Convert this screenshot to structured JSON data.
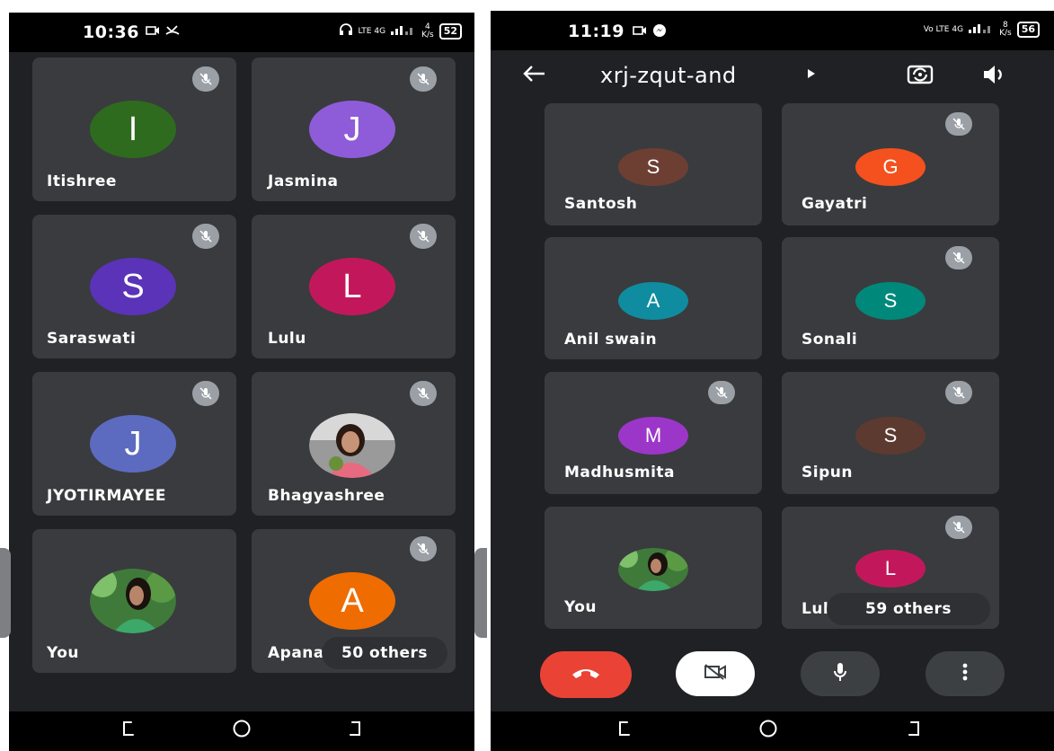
{
  "left": {
    "status": {
      "time": "10:36",
      "network": "LTE 4G",
      "speed_top": "4",
      "speed_unit": "K/s",
      "battery": "52"
    },
    "tiles": [
      {
        "name": "Itishree",
        "initial": "I",
        "color": "#2e6b1f",
        "muted": true
      },
      {
        "name": "Jasmina",
        "initial": "J",
        "color": "#8e5cd9",
        "muted": true
      },
      {
        "name": "Saraswati",
        "initial": "S",
        "color": "#5a33b8",
        "muted": true
      },
      {
        "name": "Lulu",
        "initial": "L",
        "color": "#c2185b",
        "muted": true
      },
      {
        "name": "JYOTIRMAYEE",
        "initial": "J",
        "color": "#5c6bc0",
        "muted": true
      },
      {
        "name": "Bhagyashree",
        "muted": true
      },
      {
        "name": "You",
        "muted": false
      },
      {
        "name": "Apana",
        "initial": "A",
        "color": "#ef6c00",
        "muted": true
      }
    ],
    "others_label": "50 others"
  },
  "right": {
    "status": {
      "time": "11:19",
      "network": "Vo LTE 4G",
      "speed_top": "8",
      "speed_unit": "K/s",
      "battery": "56"
    },
    "meeting_code": "xrj-zqut-and",
    "tiles": [
      {
        "name": "Santosh",
        "initial": "S",
        "color": "#6d3f33",
        "muted": false
      },
      {
        "name": "Gayatri",
        "initial": "G",
        "color": "#f4511e",
        "muted": true
      },
      {
        "name": "Anil swain",
        "initial": "A",
        "color": "#0f8ca0",
        "muted": false
      },
      {
        "name": "Sonali",
        "initial": "S",
        "color": "#00897b",
        "muted": true
      },
      {
        "name": "Madhusmita",
        "initial": "M",
        "color": "#9c36c9",
        "muted": true
      },
      {
        "name": "Sipun",
        "initial": "S",
        "color": "#5d3a30",
        "muted": true
      },
      {
        "name": "You",
        "muted": false
      },
      {
        "name": "Lulu",
        "initial": "L",
        "color": "#c2185b",
        "muted": true
      }
    ],
    "others_label": "59 others"
  },
  "icons": {
    "back": "back-arrow-icon",
    "flip": "switch-camera-icon",
    "speaker": "speaker-icon",
    "mic_off": "mic-off-icon",
    "end_call": "end-call-icon",
    "camera_off": "camera-off-icon",
    "mic": "microphone-icon",
    "more": "more-options-icon"
  },
  "colors": {
    "end_call": "#ea4335",
    "tile": "#3a3b3e",
    "background": "#202124",
    "mute_badge": "#9aa0a6"
  }
}
